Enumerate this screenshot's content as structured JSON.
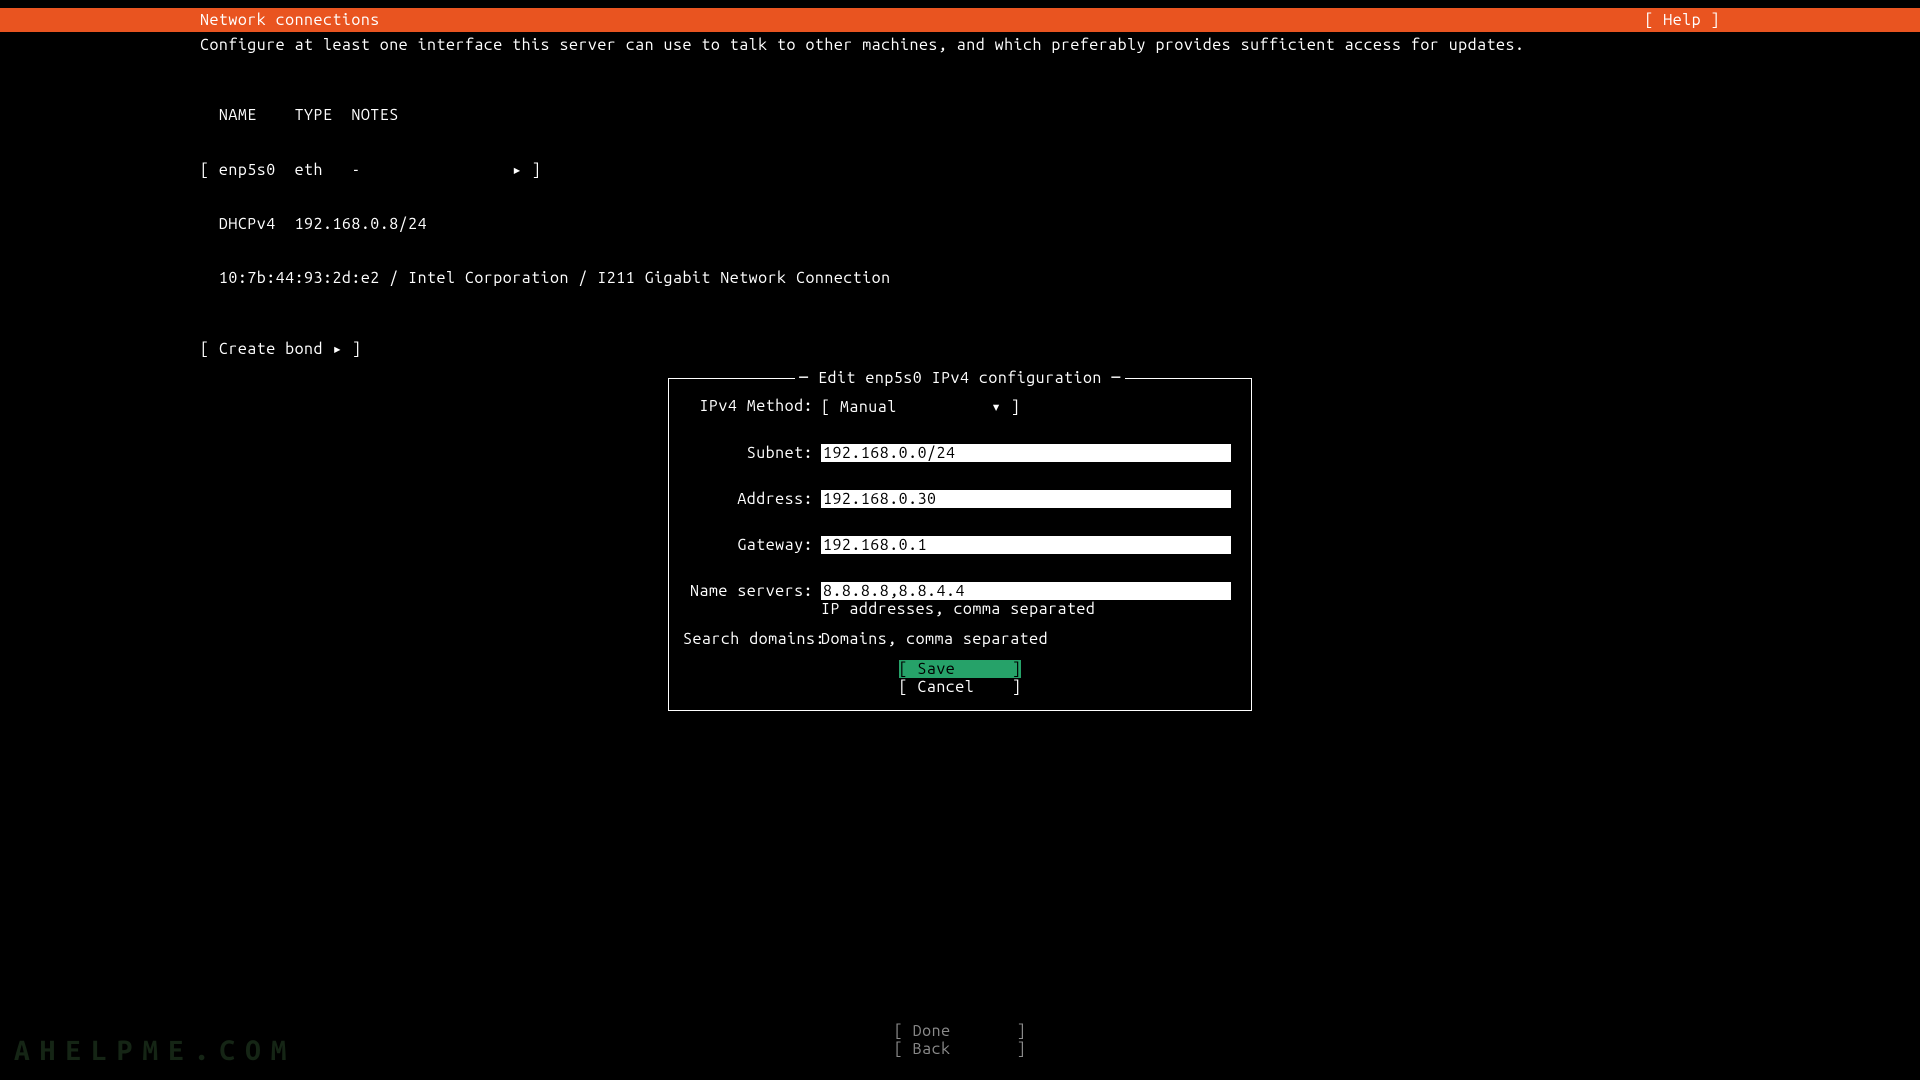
{
  "header": {
    "title": "Network connections",
    "help": "[ Help ]"
  },
  "description": "Configure at least one interface this server can use to talk to other machines, and which preferably provides sufficient access for updates.",
  "interfaces": {
    "headers": "  NAME    TYPE  NOTES",
    "row1": "[ enp5s0  eth   -                ▸ ]",
    "row2": "  DHCPv4  192.168.0.8/24",
    "row3": "  10:7b:44:93:2d:e2 / Intel Corporation / I211 Gigabit Network Connection"
  },
  "create_bond": "[ Create bond ▸ ]",
  "dialog": {
    "title": "Edit enp5s0 IPv4 configuration",
    "method_label": "IPv4 Method:",
    "method_value": "[ Manual          ▾ ]",
    "subnet_label": "Subnet:",
    "subnet_value": "192.168.0.0/24",
    "address_label": "Address:",
    "address_value": "192.168.0.30",
    "gateway_label": "Gateway:",
    "gateway_value": "192.168.0.1",
    "nameservers_label": "Name servers:",
    "nameservers_value": "8.8.8.8,8.8.4.4",
    "nameservers_hint": "IP addresses, comma separated",
    "search_label": "Search domains:",
    "search_value": " ",
    "search_hint": "Domains, comma separated",
    "save": "[ Save      ]",
    "cancel": "[ Cancel    ]"
  },
  "footer": {
    "done": "[ Done       ]",
    "back": "[ Back       ]"
  },
  "watermark": "AHELPME.COM"
}
